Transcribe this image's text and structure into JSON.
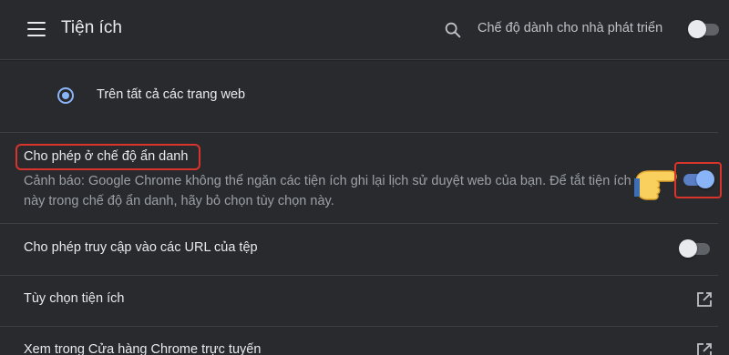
{
  "header": {
    "title": "Tiện ích",
    "dev_mode_label": "Chế độ dành cho nhà phát triển",
    "dev_mode_on": false
  },
  "site_access": {
    "option_label": "Trên tất cả các trang web",
    "selected": true
  },
  "incognito": {
    "label": "Cho phép ở chế độ ẩn danh",
    "description": "Cảnh báo: Google Chrome không thể ngăn các tiện ích ghi lại lịch sử duyệt web của bạn. Để tắt tiện ích này trong chế độ ẩn danh, hãy bỏ chọn tùy chọn này.",
    "enabled": true
  },
  "file_urls": {
    "label": "Cho phép truy cập vào các URL của tệp",
    "enabled": false
  },
  "extension_options": {
    "label": "Tùy chọn tiện ích"
  },
  "web_store": {
    "label": "Xem trong Cửa hàng Chrome trực tuyến"
  },
  "colors": {
    "accent": "#8ab4f8",
    "highlight": "#d9342b",
    "background": "#202124"
  }
}
